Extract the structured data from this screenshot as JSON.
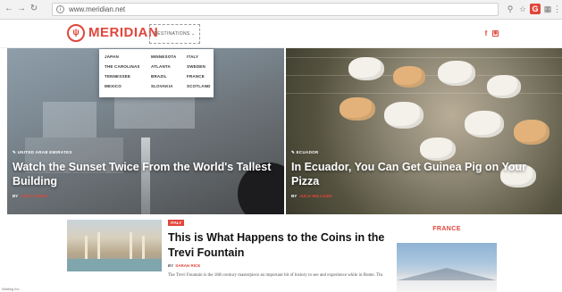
{
  "browser": {
    "url": "www.meridian.net",
    "back_icon": "arrow-left-icon",
    "forward_icon": "arrow-right-icon",
    "reload_icon": "reload-icon"
  },
  "site": {
    "logo_text": "MERIDIAN",
    "dest_menu_label": "DESTINATIONS ⌄",
    "brand_color": "#e0463b"
  },
  "dropdown": {
    "items": [
      "JAPAN",
      "MINNESOTA",
      "ITALY",
      "THE CAROLINAS",
      "ATLANTA",
      "SWEDEN",
      "TENNESSEE",
      "BRAZIL",
      "FRANCE",
      "MEXICO",
      "SLOVAKIA",
      "SCOTLAND"
    ]
  },
  "hero": [
    {
      "category": "✎ UNITED ARAB EMIRATES",
      "title": "Watch the Sunset Twice From the World's Tallest Building",
      "by": "BY",
      "author": "ALEX COHEN"
    },
    {
      "category": "✎ ECUADOR",
      "title": "In Ecuador, You Can Get Guinea Pig on Your Pizza",
      "by": "BY",
      "author": "JULIA WILLIAMS"
    }
  ],
  "article": {
    "category": "ITALY",
    "title": "This is What Happens to the Coins in the Trevi Fountain",
    "by": "BY",
    "author": "SARAH RICE",
    "excerpt": "The Trevi Fountain is the 18th century masterpiece an important bit of history to see and experience while in Rome. The fountain is famous in so many ways, down to the coins that"
  },
  "sidebar": {
    "heading": "FRANCE"
  },
  "status": {
    "text": "Waiting for..."
  }
}
